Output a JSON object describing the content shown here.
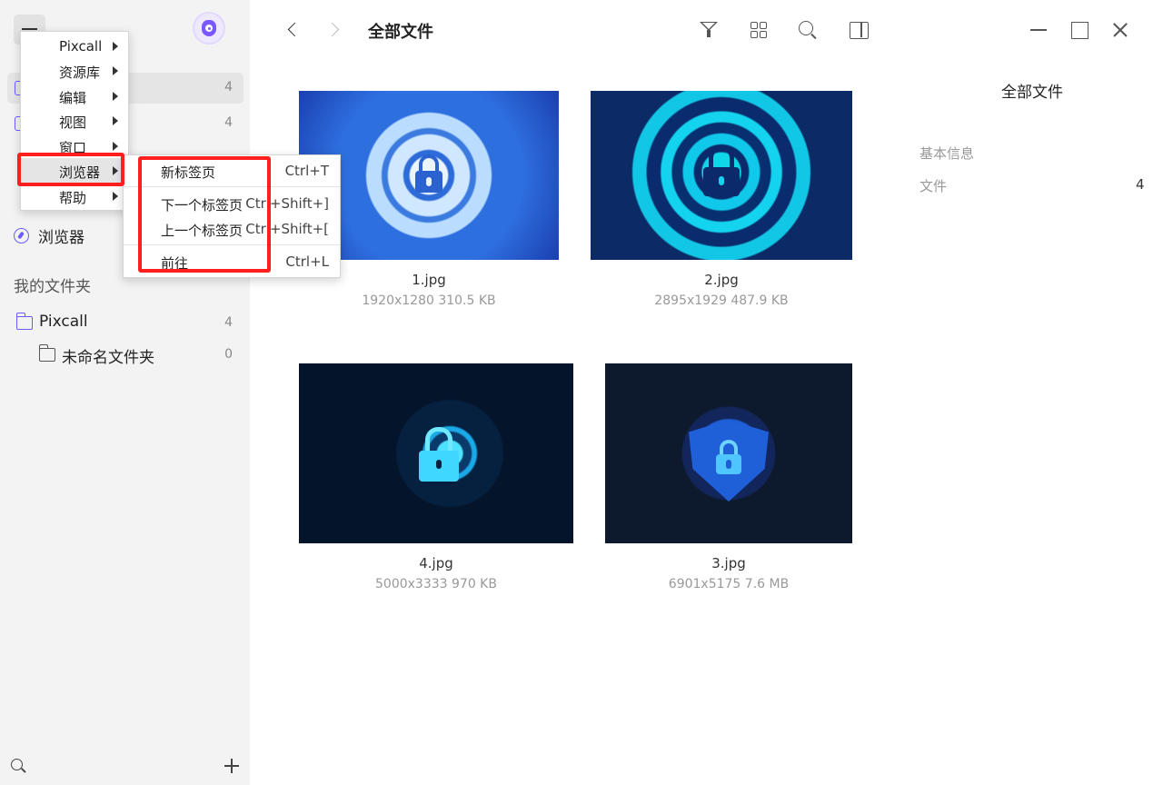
{
  "header": {
    "title": "全部文件",
    "nav_back_icon": "chevron-left-icon",
    "nav_forward_icon": "chevron-right-icon"
  },
  "sidebar": {
    "items": [
      {
        "label": "",
        "count": "4",
        "icon": "file-icon"
      },
      {
        "label": "",
        "count": "4",
        "icon": "file-icon"
      }
    ],
    "browser_label": "浏览器",
    "my_folders_title": "我的文件夹",
    "folders": [
      {
        "label": "Pixcall",
        "count": "4"
      },
      {
        "label": "未命名文件夹",
        "count": "0"
      }
    ]
  },
  "main_menu": {
    "items": [
      {
        "label": "Pixcall"
      },
      {
        "label": "资源库"
      },
      {
        "label": "编辑"
      },
      {
        "label": "视图"
      },
      {
        "label": "窗口"
      },
      {
        "label": "浏览器"
      },
      {
        "label": "帮助"
      }
    ]
  },
  "browser_submenu": {
    "items": [
      {
        "label": "新标签页",
        "shortcut": "Ctrl+T"
      },
      {
        "label": "下一个标签页",
        "shortcut": "Ctrl+Shift+]"
      },
      {
        "label": "上一个标签页",
        "shortcut": "Ctrl+Shift+["
      },
      {
        "label": "前往",
        "shortcut": "Ctrl+L"
      }
    ]
  },
  "files": [
    {
      "name": "1.jpg",
      "meta": "1920x1280   310.5 KB"
    },
    {
      "name": "2.jpg",
      "meta": "2895x1929   487.9 KB"
    },
    {
      "name": "4.jpg",
      "meta": "5000x3333   970 KB"
    },
    {
      "name": "3.jpg",
      "meta": "6901x5175   7.6 MB"
    }
  ],
  "info_panel": {
    "title": "全部文件",
    "section": "基本信息",
    "file_label": "文件",
    "file_value": "4"
  },
  "colors": {
    "accent": "#6b5cff",
    "highlight_box": "#ff1f1f"
  }
}
